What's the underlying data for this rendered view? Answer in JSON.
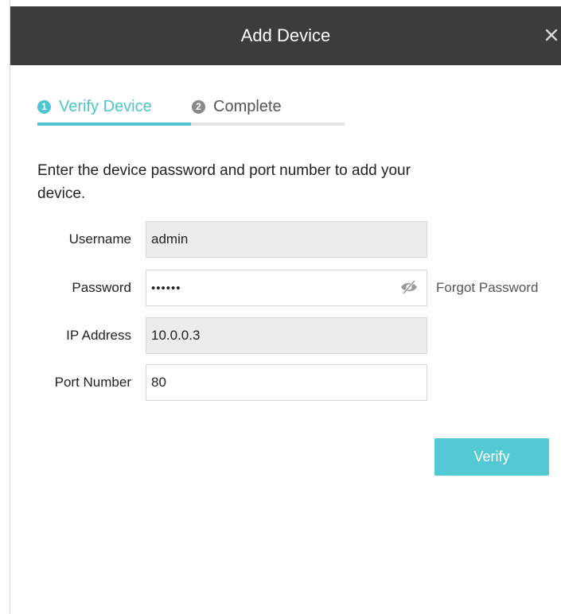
{
  "dialog": {
    "title": "Add Device",
    "close_icon": "close-icon"
  },
  "steps": [
    {
      "number": "1",
      "label": "Verify Device",
      "active": true
    },
    {
      "number": "2",
      "label": "Complete",
      "active": false
    }
  ],
  "progress": 0.5,
  "intro": "Enter the device password and port number to add your device.",
  "form": {
    "username": {
      "label": "Username",
      "value": "admin",
      "readonly": true
    },
    "password": {
      "label": "Password",
      "value": "••••••",
      "icon": "eye-slash-icon",
      "forgot_label": "Forgot Password"
    },
    "ip_address": {
      "label": "IP Address",
      "value": "10.0.0.3",
      "readonly": true
    },
    "port": {
      "label": "Port Number",
      "value": "80"
    }
  },
  "verify_label": "Verify",
  "colors": {
    "titlebar": "#3c3c3c",
    "accent": "#4ec4d0",
    "button": "#52c9d3",
    "readonly_field": "#ececec"
  }
}
